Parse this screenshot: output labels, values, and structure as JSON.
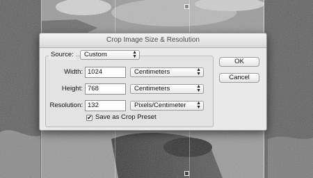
{
  "dialog": {
    "title": "Crop Image Size & Resolution",
    "source": {
      "label": "Source:",
      "value": "Custom"
    },
    "width": {
      "label": "Width:",
      "value": "1024",
      "unit": "Centimeters"
    },
    "height": {
      "label": "Height:",
      "value": "768",
      "unit": "Centimeters"
    },
    "resolution": {
      "label": "Resolution:",
      "value": "132",
      "unit": "Pixels/Centimeter"
    },
    "save_preset": {
      "label": "Save as Crop Preset",
      "checked": true
    },
    "buttons": {
      "ok": "OK",
      "cancel": "Cancel"
    }
  },
  "icons": {
    "popup_arrows": "updown-arrows-icon",
    "checkmark": "checkmark-icon"
  }
}
